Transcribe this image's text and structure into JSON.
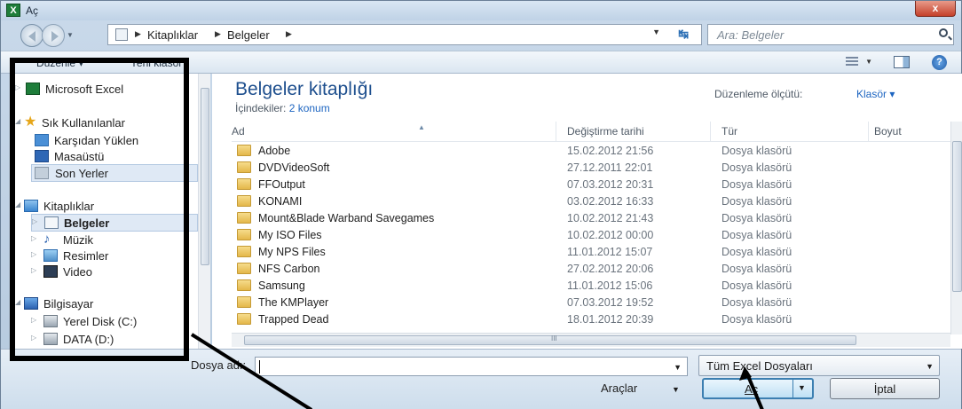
{
  "window": {
    "title": "Aç",
    "app_icon": "excel-icon",
    "close_label": "x"
  },
  "address": {
    "crumbs": [
      "Kitaplıklar",
      "Belgeler"
    ],
    "search_placeholder": "Ara: Belgeler"
  },
  "toolbar": {
    "organize": "Düzenle",
    "new_folder": "Yeni klasör"
  },
  "nav": {
    "items": [
      {
        "label": "Microsoft Excel",
        "icon": "excel-icon"
      },
      {
        "label": "Sık Kullanılanlar",
        "icon": "star-icon"
      },
      {
        "label": "Karşıdan Yüklen",
        "icon": "download-icon"
      },
      {
        "label": "Masaüstü",
        "icon": "desktop-icon"
      },
      {
        "label": "Son Yerler",
        "icon": "recent-places-icon"
      },
      {
        "label": "Kitaplıklar",
        "icon": "libraries-icon"
      },
      {
        "label": "Belgeler",
        "icon": "documents-icon"
      },
      {
        "label": "Müzik",
        "icon": "music-icon"
      },
      {
        "label": "Resimler",
        "icon": "pictures-icon"
      },
      {
        "label": "Video",
        "icon": "video-icon"
      },
      {
        "label": "Bilgisayar",
        "icon": "computer-icon"
      },
      {
        "label": "Yerel Disk (C:)",
        "icon": "disk-icon"
      },
      {
        "label": "DATA (D:)",
        "icon": "disk-icon"
      }
    ]
  },
  "library": {
    "title": "Belgeler kitaplığı",
    "includes_label": "İçindekiler:",
    "includes_link": "2 konum",
    "arrange_label": "Düzenleme ölçütü:",
    "arrange_value": "Klasör"
  },
  "columns": {
    "name": "Ad",
    "date": "Değiştirme tarihi",
    "type": "Tür",
    "size": "Boyut"
  },
  "files": [
    {
      "name": "Adobe",
      "date": "15.02.2012 21:56",
      "type": "Dosya klasörü"
    },
    {
      "name": "DVDVideoSoft",
      "date": "27.12.2011 22:01",
      "type": "Dosya klasörü"
    },
    {
      "name": "FFOutput",
      "date": "07.03.2012 20:31",
      "type": "Dosya klasörü"
    },
    {
      "name": "KONAMI",
      "date": "03.02.2012 16:33",
      "type": "Dosya klasörü"
    },
    {
      "name": "Mount&Blade Warband Savegames",
      "date": "10.02.2012 21:43",
      "type": "Dosya klasörü"
    },
    {
      "name": "My ISO Files",
      "date": "10.02.2012 00:00",
      "type": "Dosya klasörü"
    },
    {
      "name": "My NPS Files",
      "date": "11.01.2012 15:07",
      "type": "Dosya klasörü"
    },
    {
      "name": "NFS Carbon",
      "date": "27.02.2012 20:06",
      "type": "Dosya klasörü"
    },
    {
      "name": "Samsung",
      "date": "11.01.2012 15:06",
      "type": "Dosya klasörü"
    },
    {
      "name": "The KMPlayer",
      "date": "07.03.2012 19:52",
      "type": "Dosya klasörü"
    },
    {
      "name": "Trapped Dead",
      "date": "18.01.2012 20:39",
      "type": "Dosya klasörü"
    }
  ],
  "bottom": {
    "filename_label": "Dosya adı:",
    "filename_value": "",
    "filter_value": "Tüm Excel Dosyaları",
    "tools_label": "Araçlar",
    "open_label": "Aç",
    "cancel_label": "İptal"
  },
  "colors": {
    "accent": "#1e4f8e",
    "link": "#1d65c1",
    "highlight": "#000000"
  }
}
